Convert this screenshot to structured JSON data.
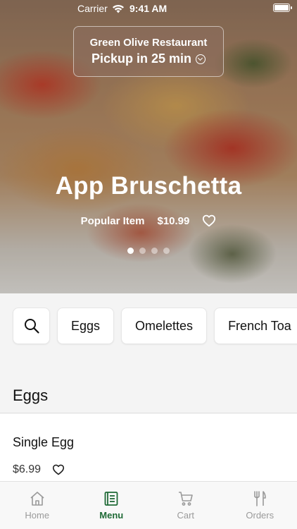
{
  "status_bar": {
    "carrier": "Carrier",
    "time": "9:41 AM"
  },
  "pickup": {
    "restaurant": "Green Olive Restaurant",
    "time_label": "Pickup in 25 min"
  },
  "hero": {
    "title": "App Bruschetta",
    "badge": "Popular Item",
    "price": "$10.99",
    "slide_count": 4,
    "active_slide": 1
  },
  "categories": [
    "Eggs",
    "Omelettes",
    "French Toa"
  ],
  "section": {
    "title": "Eggs"
  },
  "items": [
    {
      "name": "Single Egg",
      "price": "$6.99"
    }
  ],
  "tabs": [
    {
      "label": "Home",
      "icon": "home-icon"
    },
    {
      "label": "Menu",
      "icon": "menu-icon"
    },
    {
      "label": "Cart",
      "icon": "cart-icon"
    },
    {
      "label": "Orders",
      "icon": "orders-icon"
    }
  ],
  "active_tab": "Menu",
  "colors": {
    "accent": "#1f6a36",
    "tab_inactive": "#9a9a9a",
    "background": "#f4f4f4"
  }
}
